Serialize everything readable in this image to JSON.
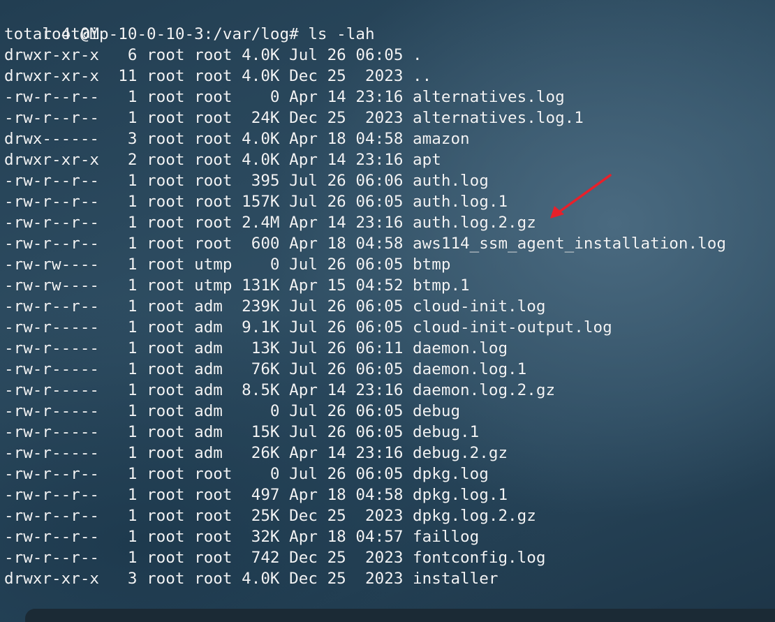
{
  "prompt": {
    "user_host": "root@ip-10-0-10-3",
    "path": "/var/log",
    "command": "ls -lah"
  },
  "total_line": "total 4.0M",
  "entries": [
    {
      "perms": "drwxr-xr-x",
      "links": "6",
      "owner": "root",
      "group": "root",
      "size": "4.0K",
      "month": "Jul",
      "day": "26",
      "time": "06:05",
      "name": "."
    },
    {
      "perms": "drwxr-xr-x",
      "links": "11",
      "owner": "root",
      "group": "root",
      "size": "4.0K",
      "month": "Dec",
      "day": "25",
      "time": "2023",
      "name": ".."
    },
    {
      "perms": "-rw-r--r--",
      "links": "1",
      "owner": "root",
      "group": "root",
      "size": "0",
      "month": "Apr",
      "day": "14",
      "time": "23:16",
      "name": "alternatives.log"
    },
    {
      "perms": "-rw-r--r--",
      "links": "1",
      "owner": "root",
      "group": "root",
      "size": "24K",
      "month": "Dec",
      "day": "25",
      "time": "2023",
      "name": "alternatives.log.1"
    },
    {
      "perms": "drwx------",
      "links": "3",
      "owner": "root",
      "group": "root",
      "size": "4.0K",
      "month": "Apr",
      "day": "18",
      "time": "04:58",
      "name": "amazon"
    },
    {
      "perms": "drwxr-xr-x",
      "links": "2",
      "owner": "root",
      "group": "root",
      "size": "4.0K",
      "month": "Apr",
      "day": "14",
      "time": "23:16",
      "name": "apt"
    },
    {
      "perms": "-rw-r--r--",
      "links": "1",
      "owner": "root",
      "group": "root",
      "size": "395",
      "month": "Jul",
      "day": "26",
      "time": "06:06",
      "name": "auth.log"
    },
    {
      "perms": "-rw-r--r--",
      "links": "1",
      "owner": "root",
      "group": "root",
      "size": "157K",
      "month": "Jul",
      "day": "26",
      "time": "06:05",
      "name": "auth.log.1"
    },
    {
      "perms": "-rw-r--r--",
      "links": "1",
      "owner": "root",
      "group": "root",
      "size": "2.4M",
      "month": "Apr",
      "day": "14",
      "time": "23:16",
      "name": "auth.log.2.gz"
    },
    {
      "perms": "-rw-r--r--",
      "links": "1",
      "owner": "root",
      "group": "root",
      "size": "600",
      "month": "Apr",
      "day": "18",
      "time": "04:58",
      "name": "aws114_ssm_agent_installation.log"
    },
    {
      "perms": "-rw-rw----",
      "links": "1",
      "owner": "root",
      "group": "utmp",
      "size": "0",
      "month": "Jul",
      "day": "26",
      "time": "06:05",
      "name": "btmp"
    },
    {
      "perms": "-rw-rw----",
      "links": "1",
      "owner": "root",
      "group": "utmp",
      "size": "131K",
      "month": "Apr",
      "day": "15",
      "time": "04:52",
      "name": "btmp.1"
    },
    {
      "perms": "-rw-r--r--",
      "links": "1",
      "owner": "root",
      "group": "adm",
      "size": "239K",
      "month": "Jul",
      "day": "26",
      "time": "06:05",
      "name": "cloud-init.log"
    },
    {
      "perms": "-rw-r-----",
      "links": "1",
      "owner": "root",
      "group": "adm",
      "size": "9.1K",
      "month": "Jul",
      "day": "26",
      "time": "06:05",
      "name": "cloud-init-output.log"
    },
    {
      "perms": "-rw-r-----",
      "links": "1",
      "owner": "root",
      "group": "adm",
      "size": "13K",
      "month": "Jul",
      "day": "26",
      "time": "06:11",
      "name": "daemon.log"
    },
    {
      "perms": "-rw-r-----",
      "links": "1",
      "owner": "root",
      "group": "adm",
      "size": "76K",
      "month": "Jul",
      "day": "26",
      "time": "06:05",
      "name": "daemon.log.1"
    },
    {
      "perms": "-rw-r-----",
      "links": "1",
      "owner": "root",
      "group": "adm",
      "size": "8.5K",
      "month": "Apr",
      "day": "14",
      "time": "23:16",
      "name": "daemon.log.2.gz"
    },
    {
      "perms": "-rw-r-----",
      "links": "1",
      "owner": "root",
      "group": "adm",
      "size": "0",
      "month": "Jul",
      "day": "26",
      "time": "06:05",
      "name": "debug"
    },
    {
      "perms": "-rw-r-----",
      "links": "1",
      "owner": "root",
      "group": "adm",
      "size": "15K",
      "month": "Jul",
      "day": "26",
      "time": "06:05",
      "name": "debug.1"
    },
    {
      "perms": "-rw-r-----",
      "links": "1",
      "owner": "root",
      "group": "adm",
      "size": "26K",
      "month": "Apr",
      "day": "14",
      "time": "23:16",
      "name": "debug.2.gz"
    },
    {
      "perms": "-rw-r--r--",
      "links": "1",
      "owner": "root",
      "group": "root",
      "size": "0",
      "month": "Jul",
      "day": "26",
      "time": "06:05",
      "name": "dpkg.log"
    },
    {
      "perms": "-rw-r--r--",
      "links": "1",
      "owner": "root",
      "group": "root",
      "size": "497",
      "month": "Apr",
      "day": "18",
      "time": "04:58",
      "name": "dpkg.log.1"
    },
    {
      "perms": "-rw-r--r--",
      "links": "1",
      "owner": "root",
      "group": "root",
      "size": "25K",
      "month": "Dec",
      "day": "25",
      "time": "2023",
      "name": "dpkg.log.2.gz"
    },
    {
      "perms": "-rw-r--r--",
      "links": "1",
      "owner": "root",
      "group": "root",
      "size": "32K",
      "month": "Apr",
      "day": "18",
      "time": "04:57",
      "name": "faillog"
    },
    {
      "perms": "-rw-r--r--",
      "links": "1",
      "owner": "root",
      "group": "root",
      "size": "742",
      "month": "Dec",
      "day": "25",
      "time": "2023",
      "name": "fontconfig.log"
    },
    {
      "perms": "drwxr-xr-x",
      "links": "3",
      "owner": "root",
      "group": "root",
      "size": "4.0K",
      "month": "Dec",
      "day": "25",
      "time": "2023",
      "name": "installer"
    }
  ],
  "annotation": {
    "icon": "red-arrow-icon",
    "color": "#e8202a",
    "points_to": "auth.log.2.gz"
  }
}
